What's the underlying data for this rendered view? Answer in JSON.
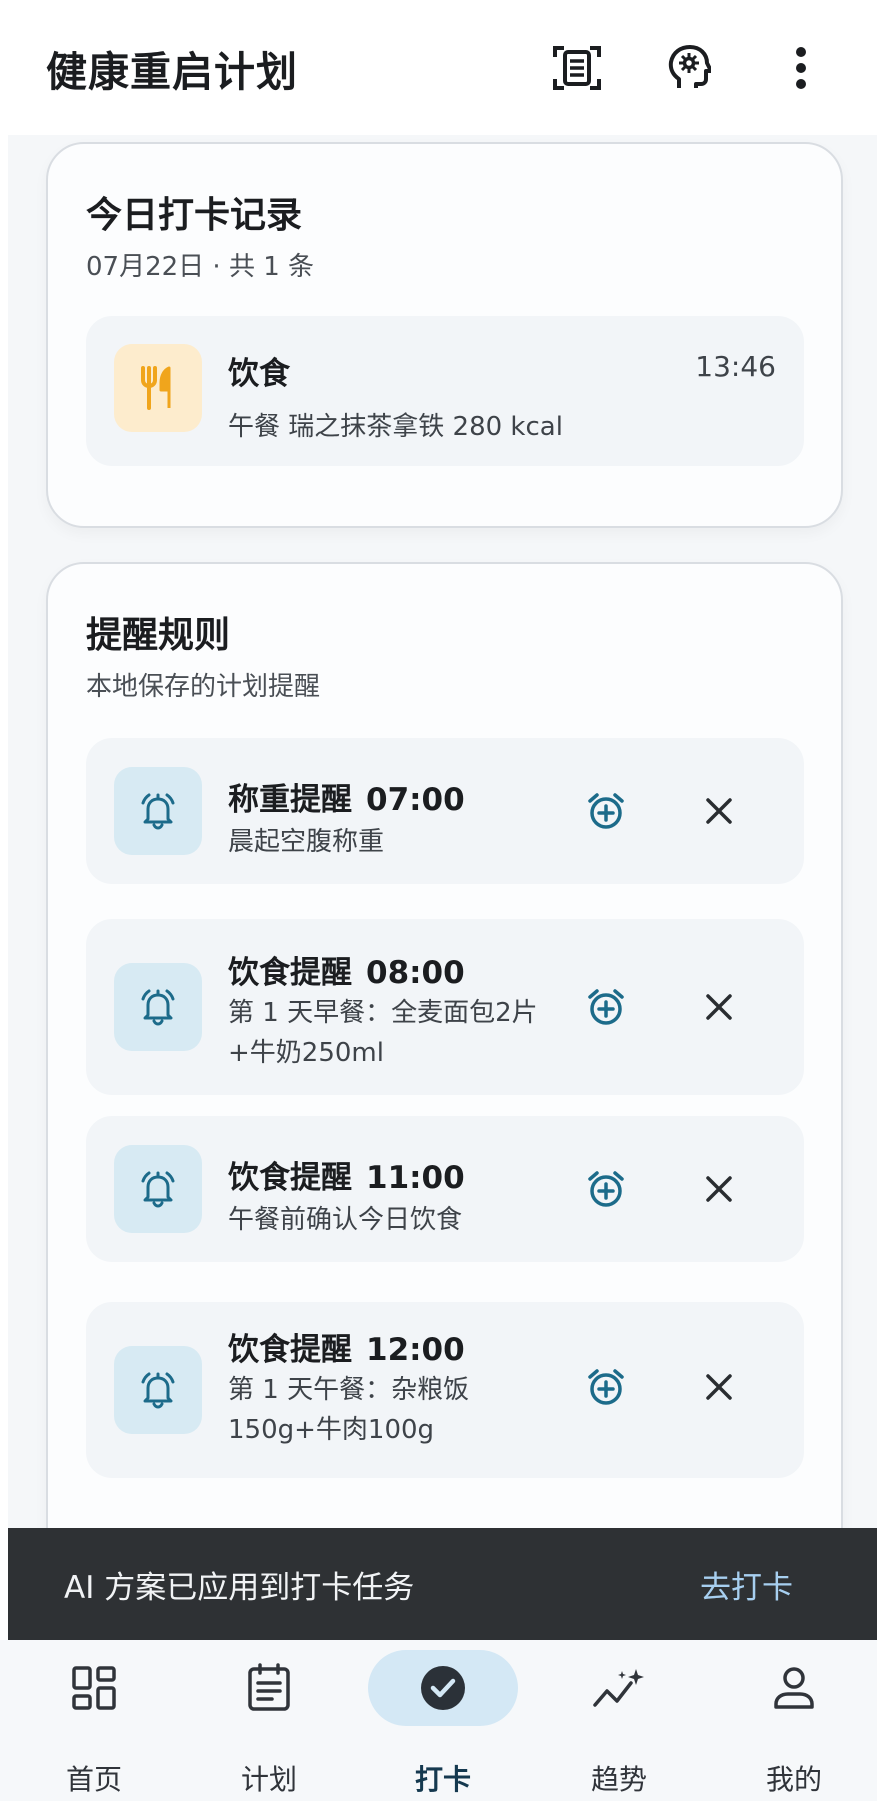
{
  "app_bar": {
    "title": "健康重启计划",
    "actions": [
      {
        "icon": "document-scan-icon"
      },
      {
        "icon": "ai-head-icon"
      },
      {
        "icon": "more-vert-icon"
      }
    ]
  },
  "records_card": {
    "title": "今日打卡记录",
    "subtitle": "07月22日 · 共 1 条",
    "items": [
      {
        "icon": "fork-knife-icon",
        "name": "饮食",
        "desc": "午餐 瑞之抹茶拿铁 280 kcal",
        "time": "13:46"
      }
    ]
  },
  "rules_card": {
    "title": "提醒规则",
    "subtitle": "本地保存的计划提醒",
    "items": [
      {
        "icon": "alarm-bell-icon",
        "name": "称重提醒",
        "time": "07:00",
        "desc": "晨起空腹称重"
      },
      {
        "icon": "alarm-bell-icon",
        "name": "饮食提醒",
        "time": "08:00",
        "desc": "第 1 天早餐：全麦面包2片+牛奶250ml"
      },
      {
        "icon": "alarm-bell-icon",
        "name": "饮食提醒",
        "time": "11:00",
        "desc": "午餐前确认今日饮食"
      },
      {
        "icon": "alarm-bell-icon",
        "name": "饮食提醒",
        "time": "12:00",
        "desc": "第 1 天午餐：杂粮饭150g+牛肉100g"
      }
    ]
  },
  "snackbar": {
    "message": "AI 方案已应用到打卡任务",
    "action": "去打卡"
  },
  "bottom_nav": {
    "items": [
      {
        "label": "首页",
        "icon": "dashboard-icon",
        "active": false
      },
      {
        "label": "计划",
        "icon": "list-icon",
        "active": false
      },
      {
        "label": "打卡",
        "icon": "check-circle-icon",
        "active": true
      },
      {
        "label": "趋势",
        "icon": "trend-sparkle-icon",
        "active": false
      },
      {
        "label": "我的",
        "icon": "person-icon",
        "active": false
      }
    ]
  },
  "colors": {
    "accent": "#1f6e8c",
    "snackbar_bg": "#2e3134",
    "snackbar_action": "#a7cff0",
    "rule_icon_bg": "#d7eaf3",
    "record_icon_bg": "#fdeccd"
  }
}
